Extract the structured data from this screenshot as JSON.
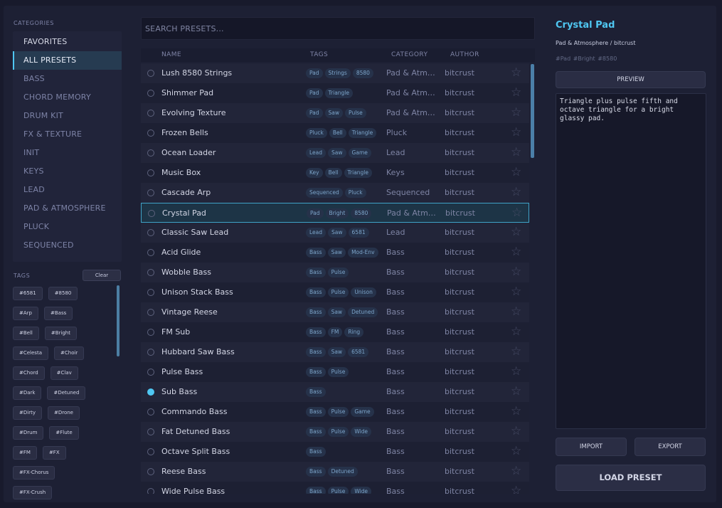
{
  "categories": {
    "label": "CATEGORIES",
    "items": [
      {
        "label": "FAVORITES"
      },
      {
        "label": "ALL PRESETS"
      },
      {
        "label": "BASS"
      },
      {
        "label": "CHORD MEMORY"
      },
      {
        "label": "DRUM KIT"
      },
      {
        "label": "FX & TEXTURE"
      },
      {
        "label": "INIT"
      },
      {
        "label": "KEYS"
      },
      {
        "label": "LEAD"
      },
      {
        "label": "PAD & ATMOSPHERE"
      },
      {
        "label": "PLUCK"
      },
      {
        "label": "SEQUENCED"
      }
    ],
    "active_index": 1
  },
  "tags_panel": {
    "label": "TAGS",
    "clear_label": "Clear",
    "rows": [
      [
        "#6581",
        "#8580"
      ],
      [
        "#Arp",
        "#Bass"
      ],
      [
        "#Bell",
        "#Bright"
      ],
      [
        "#Celesta",
        "#Choir"
      ],
      [
        "#Chord",
        "#Clav"
      ],
      [
        "#Dark",
        "#Detuned"
      ],
      [
        "#Dirty",
        "#Drone"
      ],
      [
        "#Drum",
        "#Flute"
      ],
      [
        "#FM",
        "#FX"
      ],
      [
        "#FX-Chorus"
      ],
      [
        "#FX-Crush"
      ]
    ]
  },
  "search": {
    "placeholder": "SEARCH PRESETS..."
  },
  "table": {
    "columns": {
      "name": "NAME",
      "tags": "TAGS",
      "category": "CATEGORY",
      "author": "AUTHOR"
    },
    "selected_index": 7,
    "loaded_index": 16,
    "rows": [
      {
        "name": "Lush 8580 Strings",
        "tags": [
          "Pad",
          "Strings",
          "8580"
        ],
        "category": "Pad & Atm…",
        "author": "bitcrust"
      },
      {
        "name": "Shimmer Pad",
        "tags": [
          "Pad",
          "Triangle"
        ],
        "category": "Pad & Atm…",
        "author": "bitcrust"
      },
      {
        "name": "Evolving Texture",
        "tags": [
          "Pad",
          "Saw",
          "Pulse"
        ],
        "category": "Pad & Atm…",
        "author": "bitcrust"
      },
      {
        "name": "Frozen Bells",
        "tags": [
          "Pluck",
          "Bell",
          "Triangle"
        ],
        "category": "Pluck",
        "author": "bitcrust"
      },
      {
        "name": "Ocean Loader",
        "tags": [
          "Lead",
          "Saw",
          "Game"
        ],
        "category": "Lead",
        "author": "bitcrust"
      },
      {
        "name": "Music Box",
        "tags": [
          "Key",
          "Bell",
          "Triangle"
        ],
        "category": "Keys",
        "author": "bitcrust"
      },
      {
        "name": "Cascade Arp",
        "tags": [
          "Sequenced",
          "Pluck"
        ],
        "category": "Sequenced",
        "author": "bitcrust"
      },
      {
        "name": "Crystal Pad",
        "tags": [
          "Pad",
          "Bright",
          "8580"
        ],
        "category": "Pad & Atm…",
        "author": "bitcrust"
      },
      {
        "name": "Classic Saw Lead",
        "tags": [
          "Lead",
          "Saw",
          "6581"
        ],
        "category": "Lead",
        "author": "bitcrust"
      },
      {
        "name": "Acid Glide",
        "tags": [
          "Bass",
          "Saw",
          "Mod-Env"
        ],
        "category": "Bass",
        "author": "bitcrust"
      },
      {
        "name": "Wobble Bass",
        "tags": [
          "Bass",
          "Pulse"
        ],
        "category": "Bass",
        "author": "bitcrust"
      },
      {
        "name": "Unison Stack Bass",
        "tags": [
          "Bass",
          "Pulse",
          "Unison"
        ],
        "category": "Bass",
        "author": "bitcrust"
      },
      {
        "name": "Vintage Reese",
        "tags": [
          "Bass",
          "Saw",
          "Detuned"
        ],
        "category": "Bass",
        "author": "bitcrust"
      },
      {
        "name": "FM Sub",
        "tags": [
          "Bass",
          "FM",
          "Ring"
        ],
        "category": "Bass",
        "author": "bitcrust"
      },
      {
        "name": "Hubbard Saw Bass",
        "tags": [
          "Bass",
          "Saw",
          "6581"
        ],
        "category": "Bass",
        "author": "bitcrust"
      },
      {
        "name": "Pulse Bass",
        "tags": [
          "Bass",
          "Pulse"
        ],
        "category": "Bass",
        "author": "bitcrust"
      },
      {
        "name": "Sub Bass",
        "tags": [
          "Bass"
        ],
        "category": "Bass",
        "author": "bitcrust"
      },
      {
        "name": "Commando Bass",
        "tags": [
          "Bass",
          "Pulse",
          "Game"
        ],
        "category": "Bass",
        "author": "bitcrust"
      },
      {
        "name": "Fat Detuned Bass",
        "tags": [
          "Bass",
          "Pulse",
          "Wide"
        ],
        "category": "Bass",
        "author": "bitcrust"
      },
      {
        "name": "Octave Split Bass",
        "tags": [
          "Bass"
        ],
        "category": "Bass",
        "author": "bitcrust"
      },
      {
        "name": "Reese Bass",
        "tags": [
          "Bass",
          "Detuned"
        ],
        "category": "Bass",
        "author": "bitcrust"
      },
      {
        "name": "Wide Pulse Bass",
        "tags": [
          "Bass",
          "Pulse",
          "Wide"
        ],
        "category": "Bass",
        "author": "bitcrust"
      }
    ]
  },
  "detail": {
    "title": "Crystal Pad",
    "subtitle": "Pad & Atmosphere / bitcrust",
    "tags": "#Pad #Bright #8580",
    "preview_label": "PREVIEW",
    "description": "Triangle plus pulse fifth and octave triangle for a bright glassy pad.",
    "import_label": "IMPORT",
    "export_label": "EXPORT",
    "load_label": "LOAD PRESET"
  },
  "icons": {
    "favorite": "star-icon",
    "select": "radio-icon"
  },
  "colors": {
    "accent": "#4fc7f2",
    "background": "#1d2034",
    "selected_row": "#1d3446"
  }
}
